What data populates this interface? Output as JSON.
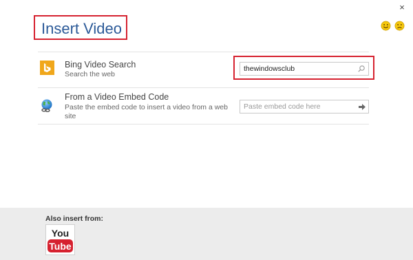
{
  "dialog": {
    "title": "Insert Video",
    "close_glyph": "×"
  },
  "sources": {
    "bing": {
      "title": "Bing Video Search",
      "subtitle": "Search the web",
      "search_value": "thewindowsclub",
      "icon": "bing-icon"
    },
    "embed": {
      "title": "From a Video Embed Code",
      "subtitle_line1": "Paste the embed code to insert a video from a web",
      "subtitle_line2": "site",
      "placeholder": "Paste embed code here",
      "icon": "globe-link-icon"
    }
  },
  "footer": {
    "also_label": "Also insert from:",
    "youtube": {
      "top": "You",
      "bottom": "Tube"
    }
  },
  "colors": {
    "highlight": "#d6212f",
    "title": "#2c5a98",
    "bing_orange": "#f0a71b",
    "youtube_red": "#d6212f",
    "footer_bg": "#ececec"
  }
}
